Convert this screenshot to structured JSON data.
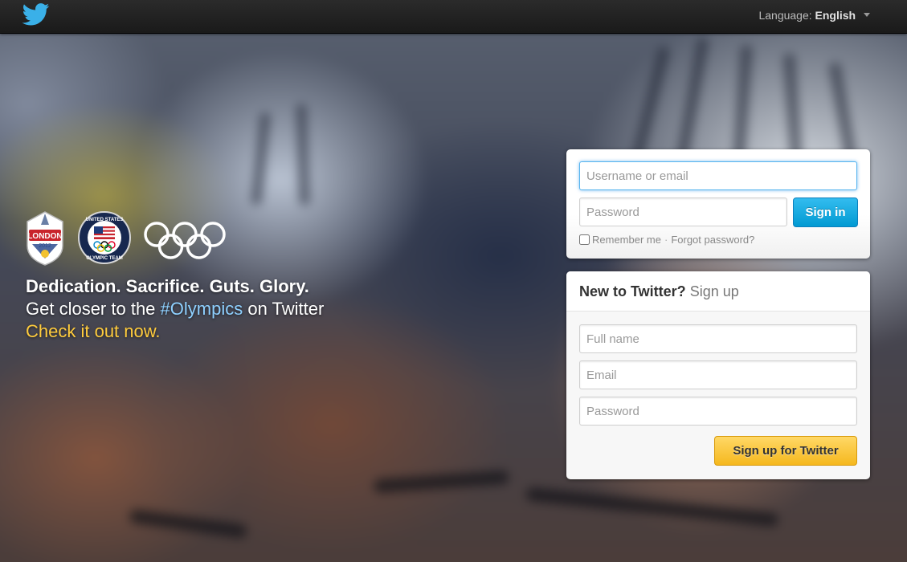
{
  "header": {
    "language_label": "Language:",
    "language_value": "English"
  },
  "promo": {
    "emblems": [
      "london-2012-emblem",
      "usoc-olympic-team-emblem",
      "olympic-rings-emblem"
    ],
    "emblem_texts": {
      "london": "LONDON",
      "london_year": "2012",
      "usoc_top": "UNITED STATES",
      "usoc_bottom": "OLYMPIC TEAM"
    },
    "headline": "Dedication. Sacrifice. Guts. Glory.",
    "line2_prefix": "Get closer to the ",
    "hashtag": "#Olympics",
    "line2_suffix": " on Twitter",
    "cta": "Check it out now."
  },
  "signin": {
    "username_placeholder": "Username or email",
    "password_placeholder": "Password",
    "button": "Sign in",
    "remember_label": "Remember me",
    "separator": "·",
    "forgot_label": "Forgot password?"
  },
  "signup": {
    "title": "New to Twitter?",
    "title_link": "Sign up",
    "fullname_placeholder": "Full name",
    "email_placeholder": "Email",
    "password_placeholder": "Password",
    "button": "Sign up for Twitter"
  },
  "colors": {
    "brand_blue": "#019ad2",
    "signup_yellow": "#f5b81e",
    "hashtag_blue": "#8ed0ff",
    "cta_yellow": "#ffcc3d"
  }
}
